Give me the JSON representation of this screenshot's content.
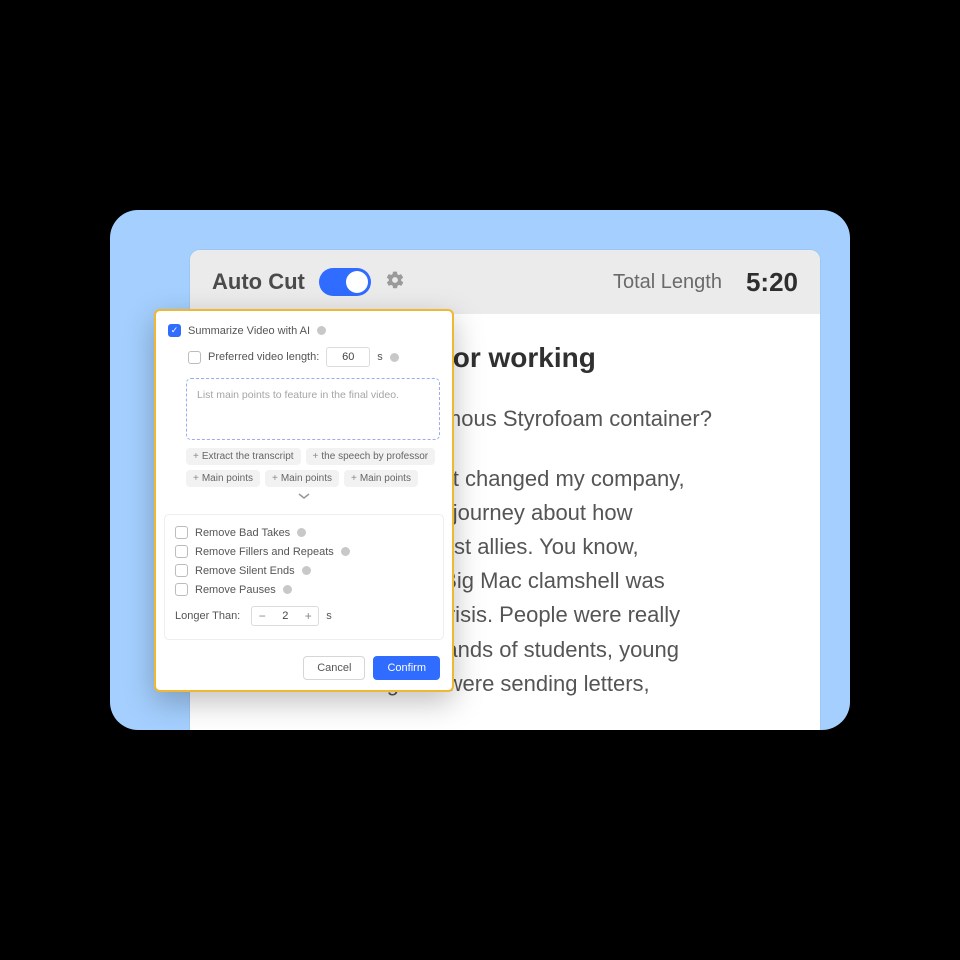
{
  "toolbar": {
    "title": "Auto Cut",
    "total_label": "Total Length",
    "total_value": "5:20"
  },
  "document": {
    "heading": "s case for working",
    "para1": "s this infamous Styrofoam container?",
    "para2": "nged me, it changed my company,\nrevelatory journey about how\nbe your best allies. You know,\n'80s, this Big Mac clamshell was\ngarbage crisis. People were really\nple, thousands of students, young\n the globe were sending letters,"
  },
  "modal": {
    "summarize": {
      "label": "Summarize Video with AI",
      "pref_label": "Preferred video length:",
      "pref_value": "60",
      "pref_unit": "s",
      "prompt_placeholder": "List main points to feature in the final video.",
      "chips": [
        "Extract the transcript",
        "the speech by professor",
        "Main points",
        "Main points",
        "Main points"
      ]
    },
    "options": {
      "bad_takes": "Remove Bad Takes",
      "fillers": "Remove Fillers and Repeats",
      "silent_ends": "Remove Silent Ends",
      "pauses": "Remove Pauses",
      "longer_than_label": "Longer Than:",
      "longer_than_value": "2",
      "longer_than_unit": "s"
    },
    "footer": {
      "cancel": "Cancel",
      "confirm": "Confirm"
    }
  }
}
